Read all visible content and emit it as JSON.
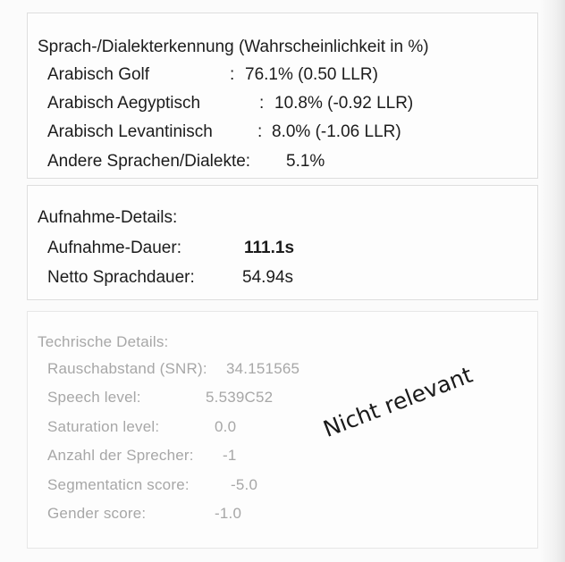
{
  "language_section": {
    "title": "Sprach-/Dialekterkennung (Wahrscheinlichkeit in %)",
    "rows": [
      {
        "label": "Arabisch Golf",
        "sep": ":",
        "value": "76.1% (0.50 LLR)"
      },
      {
        "label": "Arabisch Aegyptisch",
        "sep": ":",
        "value": "10.8% (-0.92 LLR)"
      },
      {
        "label": "Arabisch Levantinisch",
        "sep": ":",
        "value": "8.0% (-1.06 LLR)"
      },
      {
        "label": "Andere Sprachen/Dialekte:",
        "value": "5.1%"
      }
    ]
  },
  "recording_section": {
    "title": "Aufnahme-Details:",
    "rows": [
      {
        "label": "Aufnahme-Dauer:",
        "value": "111.1s"
      },
      {
        "label": "Netto Sprachdauer:",
        "value": "54.94s"
      }
    ]
  },
  "technical_section": {
    "title": "Techrische Details:",
    "rows": [
      {
        "label": "Rauschabstand (SNR):",
        "value": "34.151565"
      },
      {
        "label": "Speech level:",
        "value": "5.539C52"
      },
      {
        "label": "Saturation level:",
        "value": "0.0"
      },
      {
        "label": "Anzahl der Sprecher:",
        "value": "-1"
      },
      {
        "label": "Segmentaticn score:",
        "value": "-5.0"
      },
      {
        "label": "Gender score:",
        "value": "-1.0"
      }
    ]
  },
  "annotation": "Nicht relevant"
}
